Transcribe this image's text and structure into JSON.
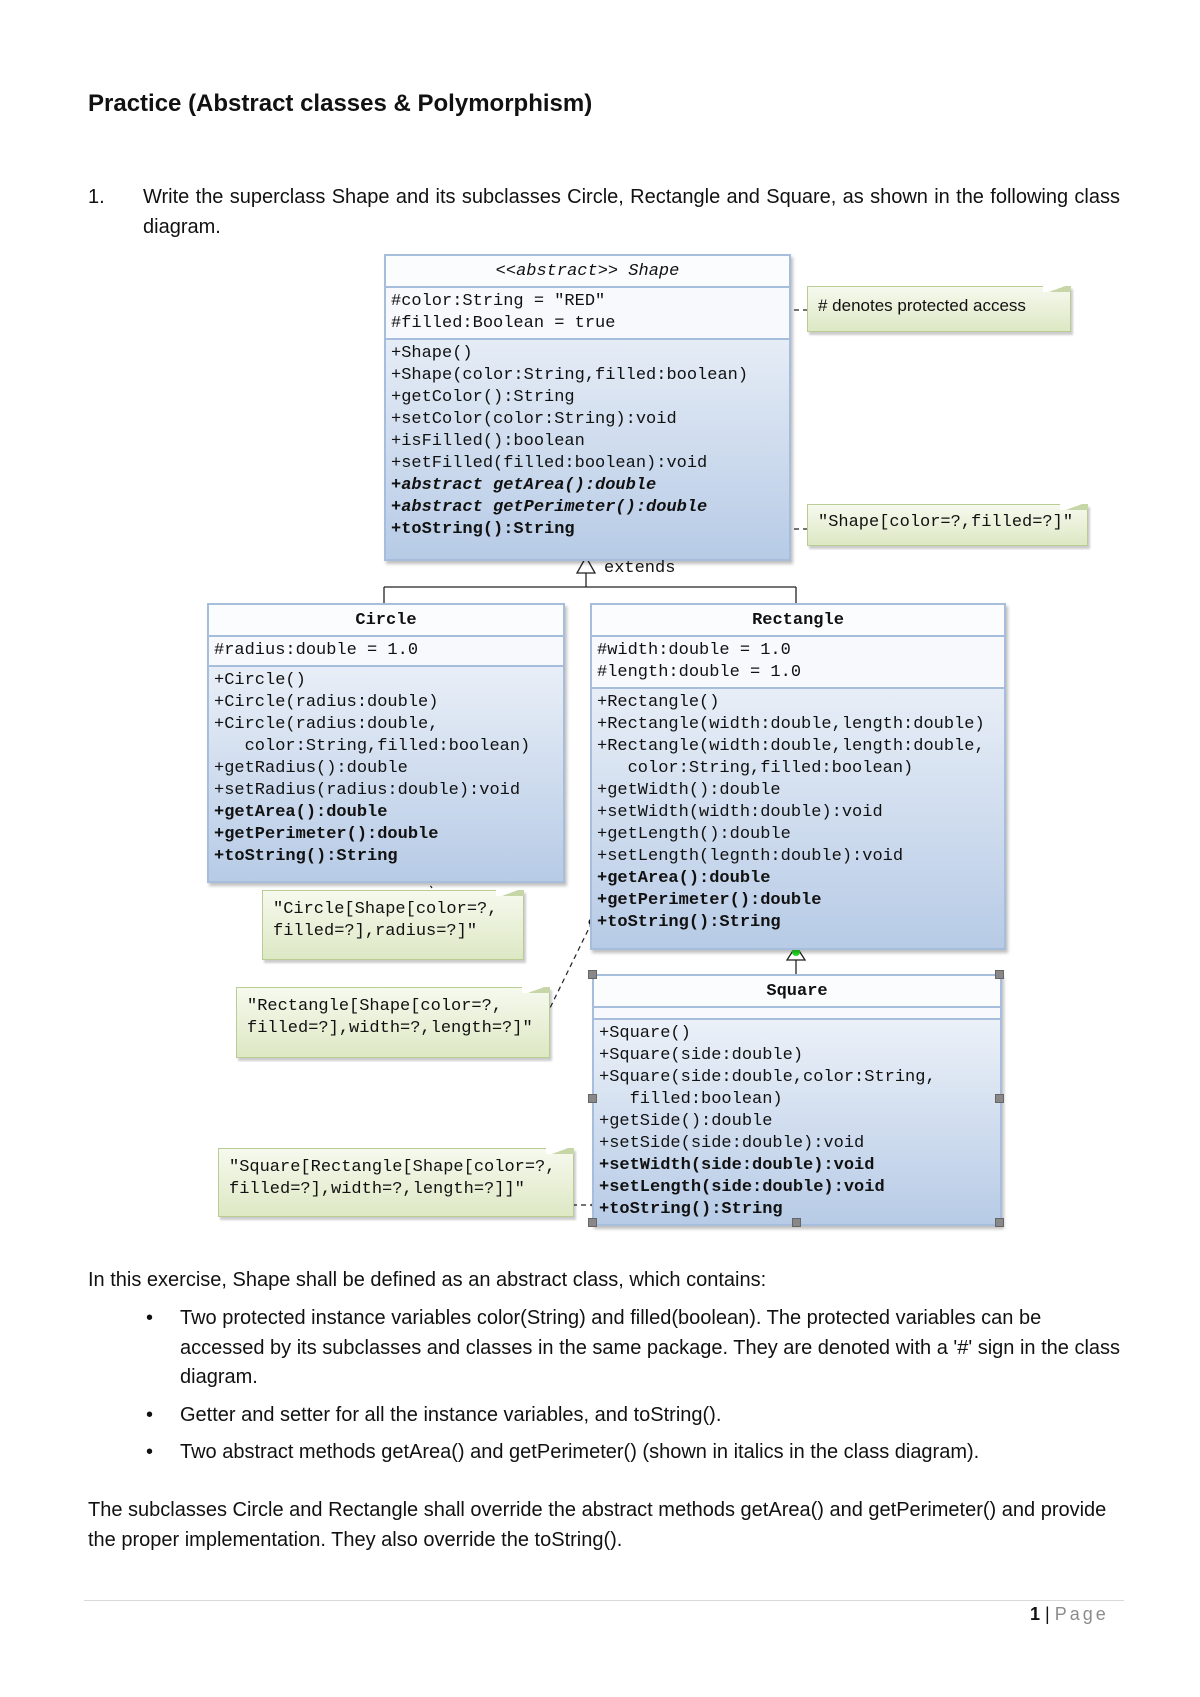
{
  "title": "Practice (Abstract classes  & Polymorphism)",
  "question": {
    "number": "1.",
    "text": "Write the superclass Shape and its subclasses Circle, Rectangle and Square, as shown in the following class diagram."
  },
  "diagram": {
    "extends_label": "extends",
    "classes": {
      "shape": {
        "stereotype": "<<abstract>>",
        "name": "Shape",
        "attributes": [
          "#color:String = \"RED\"",
          "#filled:Boolean = true"
        ],
        "methods": [
          {
            "text": "+Shape()",
            "style": "normal"
          },
          {
            "text": "+Shape(color:String,filled:boolean)",
            "style": "normal"
          },
          {
            "text": "+getColor():String",
            "style": "normal"
          },
          {
            "text": "+setColor(color:String):void",
            "style": "normal"
          },
          {
            "text": "+isFilled():boolean",
            "style": "normal"
          },
          {
            "text": "+setFilled(filled:boolean):void",
            "style": "normal"
          },
          {
            "text": "+abstract getArea():double",
            "style": "abstract"
          },
          {
            "text": "+abstract getPerimeter():double",
            "style": "abstract"
          },
          {
            "text": "+toString():String",
            "style": "bold"
          }
        ]
      },
      "circle": {
        "name": "Circle",
        "attributes": [
          "#radius:double = 1.0"
        ],
        "methods": [
          {
            "text": "+Circle()",
            "style": "normal"
          },
          {
            "text": "+Circle(radius:double)",
            "style": "normal"
          },
          {
            "text": "+Circle(radius:double,",
            "style": "normal"
          },
          {
            "text": "   color:String,filled:boolean)",
            "style": "normal"
          },
          {
            "text": "+getRadius():double",
            "style": "normal"
          },
          {
            "text": "+setRadius(radius:double):void",
            "style": "normal"
          },
          {
            "text": "+getArea():double",
            "style": "bold"
          },
          {
            "text": "+getPerimeter():double",
            "style": "bold"
          },
          {
            "text": "+toString():String",
            "style": "bold"
          }
        ]
      },
      "rectangle": {
        "name": "Rectangle",
        "attributes": [
          "#width:double = 1.0",
          "#length:double = 1.0"
        ],
        "methods": [
          {
            "text": "+Rectangle()",
            "style": "normal"
          },
          {
            "text": "+Rectangle(width:double,length:double)",
            "style": "normal"
          },
          {
            "text": "+Rectangle(width:double,length:double,",
            "style": "normal"
          },
          {
            "text": "   color:String,filled:boolean)",
            "style": "normal"
          },
          {
            "text": "+getWidth():double",
            "style": "normal"
          },
          {
            "text": "+setWidth(width:double):void",
            "style": "normal"
          },
          {
            "text": "+getLength():double",
            "style": "normal"
          },
          {
            "text": "+setLength(legnth:double):void",
            "style": "normal"
          },
          {
            "text": "+getArea():double",
            "style": "bold"
          },
          {
            "text": "+getPerimeter():double",
            "style": "bold"
          },
          {
            "text": "+toString():String",
            "style": "bold"
          }
        ]
      },
      "square": {
        "name": "Square",
        "attributes": [],
        "methods": [
          {
            "text": "+Square()",
            "style": "normal"
          },
          {
            "text": "+Square(side:double)",
            "style": "normal"
          },
          {
            "text": "+Square(side:double,color:String,",
            "style": "normal"
          },
          {
            "text": "   filled:boolean)",
            "style": "normal"
          },
          {
            "text": "+getSide():double",
            "style": "normal"
          },
          {
            "text": "+setSide(side:double):void",
            "style": "normal"
          },
          {
            "text": "+setWidth(side:double):void",
            "style": "bold"
          },
          {
            "text": "+setLength(side:double):void",
            "style": "bold"
          },
          {
            "text": "+toString():String",
            "style": "bold"
          }
        ]
      }
    },
    "notes": {
      "protected": "# denotes protected access",
      "shape_tostring": "\"Shape[color=?,filled=?]\"",
      "circle_tostring": "\"Circle[Shape[color=?,\nfilled=?],radius=?]\"",
      "rectangle_tostring": "\"Rectangle[Shape[color=?,\nfilled=?],width=?,length=?]\"",
      "square_tostring": "\"Square[Rectangle[Shape[color=?,\nfilled=?],width=?,length=?]]\""
    }
  },
  "intro": "In this exercise, Shape shall be defined as an abstract class, which contains:",
  "bullets": [
    "Two protected instance variables color(String) and filled(boolean). The protected variables can be accessed by its subclasses and classes in the same package. They are denoted with a '#' sign in the class diagram.",
    "Getter and setter for all the instance variables, and toString().",
    "Two abstract methods getArea() and getPerimeter() (shown in italics in the class diagram)."
  ],
  "bullet_symbol": "•",
  "outro": "The subclasses Circle and Rectangle shall override the abstract methods getArea() and getPerimeter() and provide the proper implementation. They also override the toString().",
  "footer": {
    "page_number": "1",
    "separator": "|",
    "page_label": "Page"
  }
}
